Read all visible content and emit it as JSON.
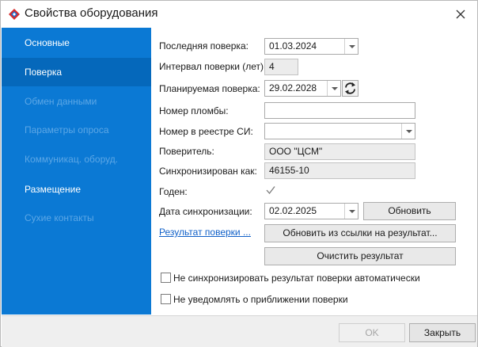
{
  "window": {
    "title": "Свойства оборудования"
  },
  "sidebar": {
    "items": [
      {
        "label": "Основные",
        "state": "normal"
      },
      {
        "label": "Поверка",
        "state": "active"
      },
      {
        "label": "Обмен данными",
        "state": "disabled"
      },
      {
        "label": "Параметры опроса",
        "state": "disabled"
      },
      {
        "label": "Коммуникац. оборуд.",
        "state": "disabled"
      },
      {
        "label": "Размещение",
        "state": "normal"
      },
      {
        "label": "Сухие контакты",
        "state": "disabled"
      }
    ]
  },
  "form": {
    "last_check": {
      "label": "Последняя поверка:",
      "value": "01.03.2024"
    },
    "interval": {
      "label": "Интервал поверки (лет):",
      "value": "4"
    },
    "planned_check": {
      "label": "Планируемая поверка:",
      "value": "29.02.2028"
    },
    "seal_number": {
      "label": "Номер пломбы:",
      "value": ""
    },
    "registry_number": {
      "label": "Номер в реестре СИ:",
      "value": ""
    },
    "verifier": {
      "label": "Поверитель:",
      "value": "ООО \"ЦСМ\""
    },
    "synced_as": {
      "label": "Синхронизирован как:",
      "value": "46155-10"
    },
    "valid": {
      "label": "Годен:",
      "checked": true
    },
    "sync_date": {
      "label": "Дата синхронизации:",
      "value": "02.02.2025"
    },
    "result_link": "Результат поверки ...",
    "update_button": "Обновить",
    "update_from_link_button": "Обновить из ссылки на результат...",
    "clear_result_button": "Очистить результат",
    "no_auto_sync": {
      "label": "Не синхронизировать результат поверки автоматически",
      "checked": false
    },
    "no_notify": {
      "label": "Не уведомлять о приближении поверки",
      "checked": false
    }
  },
  "footer": {
    "ok_label": "OK",
    "close_label": "Закрыть"
  },
  "colors": {
    "sidebar": "#0b79d4",
    "sidebar_active": "#0568bb",
    "link": "#1060c8"
  }
}
